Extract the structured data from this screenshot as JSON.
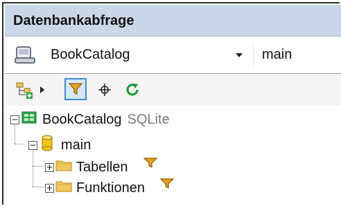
{
  "panel": {
    "title": "Datenbankabfrage"
  },
  "connection": {
    "datasource": "BookCatalog",
    "schema": "main",
    "db_icon": "database-connection-icon",
    "dropdown_icon": "chevron-down-icon"
  },
  "toolbar": {
    "items": [
      {
        "icon": "add-object-icon"
      },
      {
        "icon": "caret-right-icon"
      },
      {
        "icon": "filter-icon",
        "active": true
      },
      {
        "icon": "locate-crosshair-icon"
      },
      {
        "icon": "refresh-icon"
      }
    ]
  },
  "tree": {
    "root": {
      "label": "BookCatalog",
      "type": "SQLite",
      "expanded": true
    },
    "schema": {
      "label": "main",
      "expanded": true
    },
    "folders": [
      {
        "label": "Tabellen",
        "expanded": false
      },
      {
        "label": "Funktionen",
        "expanded": false
      }
    ]
  },
  "colors": {
    "title_bg": "#c9d7e8",
    "filter_highlight": "#d6e8f8",
    "filter_border": "#3c8bd6",
    "funnel": "#e8a317",
    "refresh": "#1f9a33",
    "folder": "#f0c85a",
    "db_cylinder": "#f5c518"
  }
}
